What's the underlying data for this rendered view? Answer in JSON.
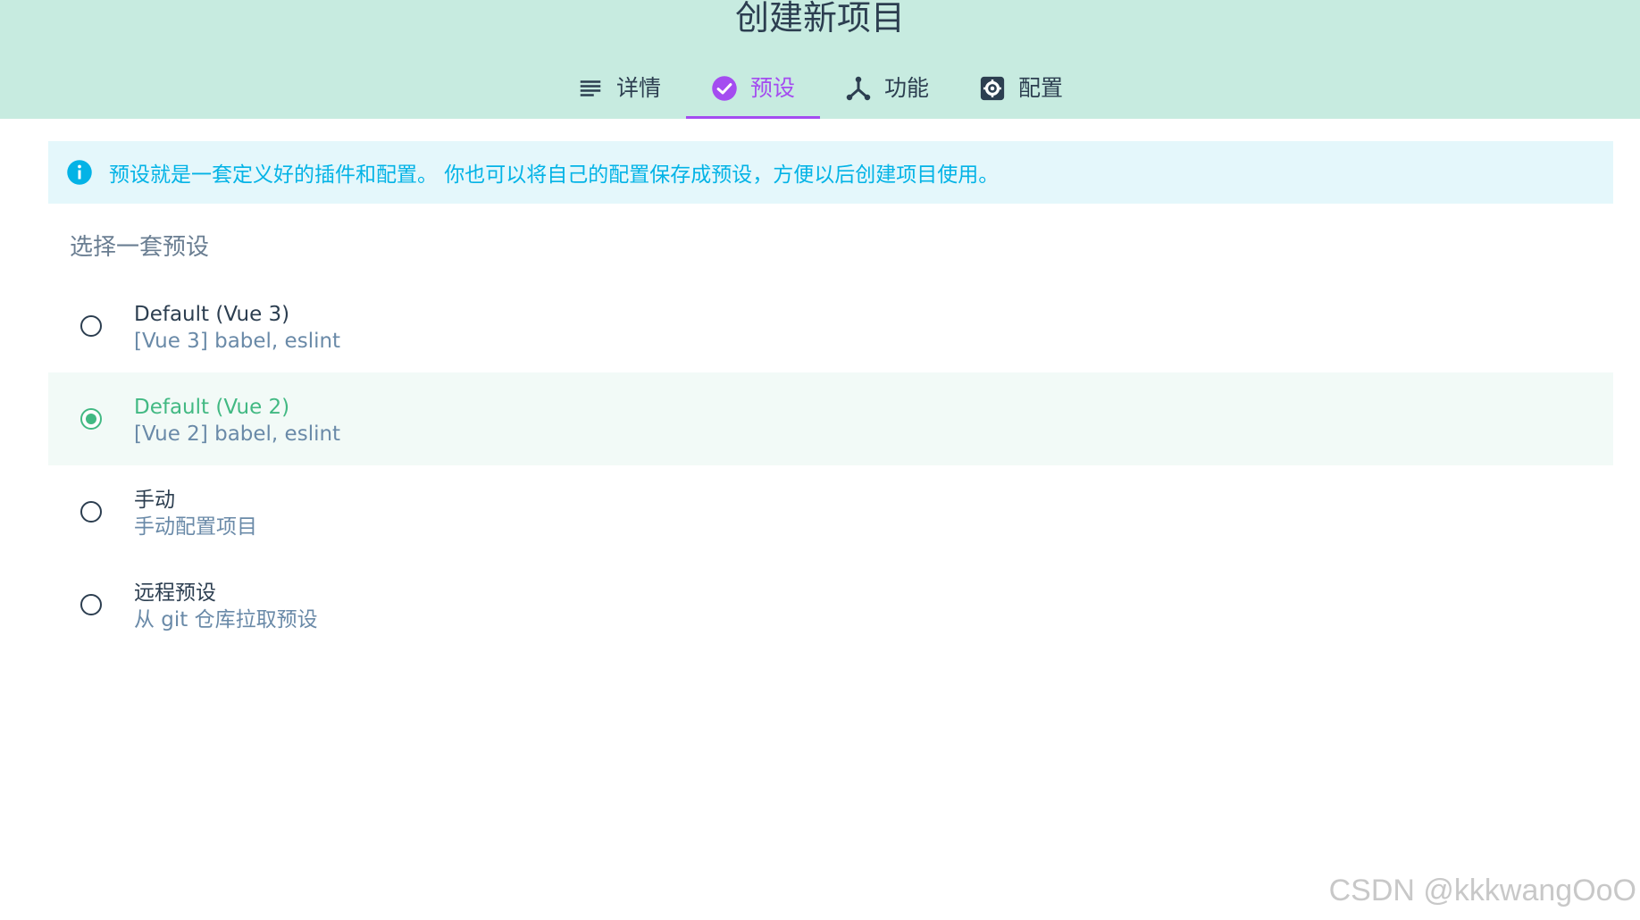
{
  "header": {
    "title": "创建新项目",
    "background": "#c7ebe0"
  },
  "tabs": [
    {
      "label": "详情",
      "icon": "list-icon",
      "active": false
    },
    {
      "label": "预设",
      "icon": "check-circle-icon",
      "active": true
    },
    {
      "label": "功能",
      "icon": "fork-icon",
      "active": false
    },
    {
      "label": "配置",
      "icon": "settings-icon",
      "active": false
    }
  ],
  "info": {
    "icon": "info-icon",
    "text": "预设就是一套定义好的插件和配置。 你也可以将自己的配置保存成预设，方便以后创建项目使用。"
  },
  "section_title": "选择一套预设",
  "options": [
    {
      "name": "Default (Vue 3)",
      "description": "[Vue 3] babel, eslint",
      "selected": false
    },
    {
      "name": "Default (Vue 2)",
      "description": "[Vue 2] babel, eslint",
      "selected": true
    },
    {
      "name": "手动",
      "description": "手动配置项目",
      "selected": false
    },
    {
      "name": "远程预设",
      "description": "从 git 仓库拉取预设",
      "selected": false
    }
  ],
  "watermark": "CSDN @kkkwangOoO",
  "colors": {
    "accent": "#a44cf0",
    "selected": "#42b983",
    "info": "#03b3e6"
  }
}
